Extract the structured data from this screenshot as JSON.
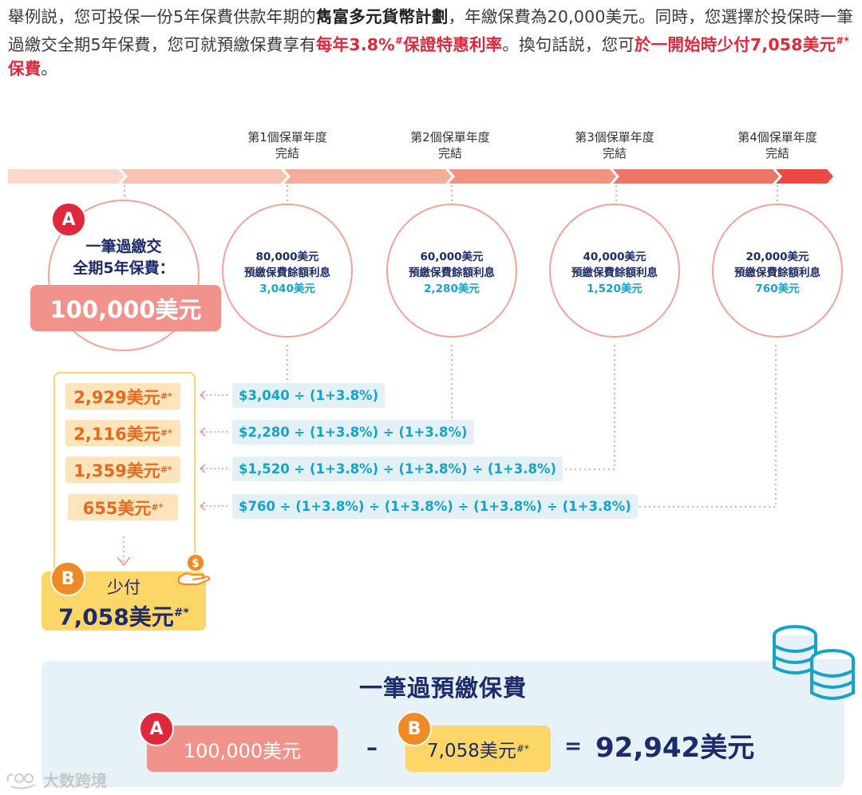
{
  "intro": {
    "p1": "舉例説，您可投保一份5年保費供款年期的",
    "plan": "雋富多元貨幣計劃",
    "p2": "，年繳保費為20,000美元。同時，您選擇於投保時一筆過繳交全期5年保費，您可就預繳保費享有",
    "rate": "每年3.8%",
    "rate_sup": "#",
    "rate_tail": "保證特惠利率",
    "p3": "。換句話説，您可",
    "less": "於一開始時少付7,058美元",
    "less_sup": "#*",
    "less_tail": "保費",
    "p4": "。"
  },
  "timeline": {
    "labels": [
      {
        "line1": "第1個保單年度",
        "line2": "完結"
      },
      {
        "line1": "第2個保單年度",
        "line2": "完結"
      },
      {
        "line1": "第3個保單年度",
        "line2": "完結"
      },
      {
        "line1": "第4個保單年度",
        "line2": "完結"
      }
    ]
  },
  "circle_a": {
    "badge": "A",
    "line1": "一筆過繳交",
    "line2": "全期5年保費：",
    "amount": "100,000美元"
  },
  "circles": [
    {
      "balance": "80,000美元",
      "desc": "預繳保費餘額利息",
      "interest": "3,040美元"
    },
    {
      "balance": "60,000美元",
      "desc": "預繳保費餘額利息",
      "interest": "2,280美元"
    },
    {
      "balance": "40,000美元",
      "desc": "預繳保費餘額利息",
      "interest": "1,520美元"
    },
    {
      "balance": "20,000美元",
      "desc": "預繳保費餘額利息",
      "interest": "760美元"
    }
  ],
  "rows": [
    {
      "value": "2,929美元",
      "sup": "#*",
      "formula": "$3,040 ÷ (1+3.8%)"
    },
    {
      "value": "2,116美元",
      "sup": "#*",
      "formula": "$2,280 ÷ (1+3.8%) ÷ (1+3.8%)"
    },
    {
      "value": "1,359美元",
      "sup": "#*",
      "formula": "$1,520 ÷ (1+3.8%) ÷ (1+3.8%) ÷ (1+3.8%)"
    },
    {
      "value": "655美元",
      "sup": "#*",
      "formula": "$760 ÷ (1+3.8%) ÷ (1+3.8%) ÷ (1+3.8%) ÷ (1+3.8%)"
    }
  ],
  "box_b": {
    "badge": "B",
    "label": "少付",
    "amount": "7,058美元",
    "sup": "#*"
  },
  "summary": {
    "title": "一筆過預繳保費",
    "a_badge": "A",
    "a_value": "100,000美元",
    "minus": "–",
    "b_badge": "B",
    "b_value": "7,058美元",
    "b_sup": "#*",
    "equals": "=",
    "result": "92,942美元"
  },
  "watermark": "大数跨境",
  "icons": [
    "money-hand-icon",
    "coin-stack-icon",
    "watermark-logo-icon"
  ],
  "colors": {
    "red": "#e0283c",
    "salmon": "#f0a499",
    "orange": "#f08a24",
    "yellow": "#fcd666",
    "navy": "#1b2b6b",
    "cyan": "#16a3c9",
    "lightblue": "#e6f2f8"
  }
}
